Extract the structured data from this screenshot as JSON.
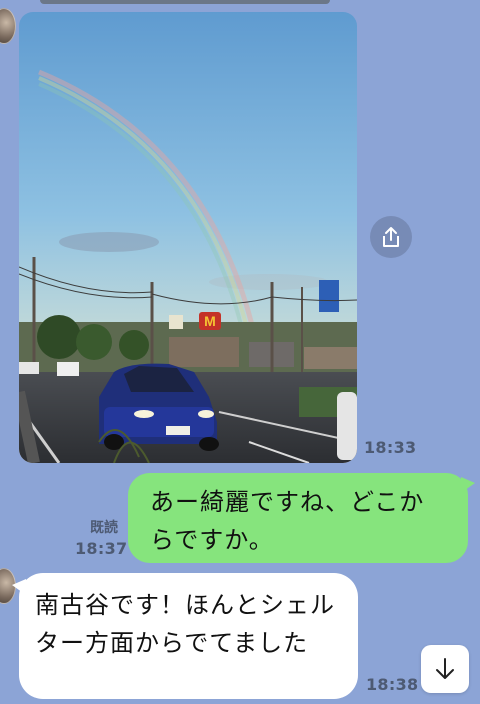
{
  "chat": {
    "photo": {
      "time": "18:33"
    },
    "outgoing": {
      "text": "あー綺麗ですね、どこからですか。",
      "read_label": "既読",
      "time": "18:37"
    },
    "incoming": {
      "text": "南古谷です！ほんとシェルター方面からでてました",
      "time": "18:38"
    }
  },
  "colors": {
    "background": "#8ca4d6",
    "outgoing_bubble": "#86e47d",
    "incoming_bubble": "#ffffff"
  },
  "icons": {
    "share": "share-icon",
    "scroll": "arrow-down-icon"
  }
}
